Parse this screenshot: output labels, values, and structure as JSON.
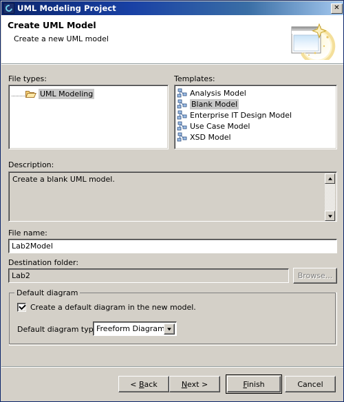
{
  "window": {
    "title": "UML Modeling Project",
    "icon": "uml-project-icon",
    "close_label": "✕"
  },
  "header": {
    "title": "Create UML Model",
    "subtitle": "Create a new UML model",
    "banner_icon": "wizard-new-model-icon"
  },
  "file_types": {
    "label": "File types:",
    "items": [
      {
        "label": "UML Modeling",
        "icon": "folder-open-icon",
        "selected": true
      }
    ]
  },
  "templates": {
    "label": "Templates:",
    "items": [
      {
        "label": "Analysis Model",
        "icon": "uml-model-icon",
        "selected": false
      },
      {
        "label": "Blank Model",
        "icon": "uml-model-icon",
        "selected": true
      },
      {
        "label": "Enterprise IT Design Model",
        "icon": "uml-model-icon",
        "selected": false
      },
      {
        "label": "Use Case Model",
        "icon": "uml-model-icon",
        "selected": false
      },
      {
        "label": "XSD Model",
        "icon": "uml-model-icon",
        "selected": false
      }
    ]
  },
  "description": {
    "label": "Description:",
    "text": "Create a blank UML model."
  },
  "file_name": {
    "label": "File name:",
    "value": "Lab2Model"
  },
  "destination": {
    "label": "Destination folder:",
    "value": "Lab2",
    "browse_label": "Browse..."
  },
  "default_diagram": {
    "group_label": "Default diagram",
    "checkbox_label": "Create a default diagram in the new model.",
    "checked": true,
    "type_label": "Default diagram type:",
    "selected_type": "Freeform Diagram",
    "options": [
      "Freeform Diagram"
    ]
  },
  "buttons": {
    "back": {
      "pre": "< ",
      "mnemonic": "B",
      "post": "ack"
    },
    "next": {
      "pre": "",
      "mnemonic": "N",
      "post": "ext >"
    },
    "finish": {
      "pre": "",
      "mnemonic": "F",
      "post": "inish"
    },
    "cancel": {
      "label": "Cancel"
    }
  },
  "colors": {
    "dialog_face": "#d4d0c8",
    "title_active_start": "#0a246a",
    "title_active_end": "#a6caf0",
    "selection_gray": "#c8c8c8",
    "field_white": "#ffffff",
    "disabled_text": "#808080"
  }
}
